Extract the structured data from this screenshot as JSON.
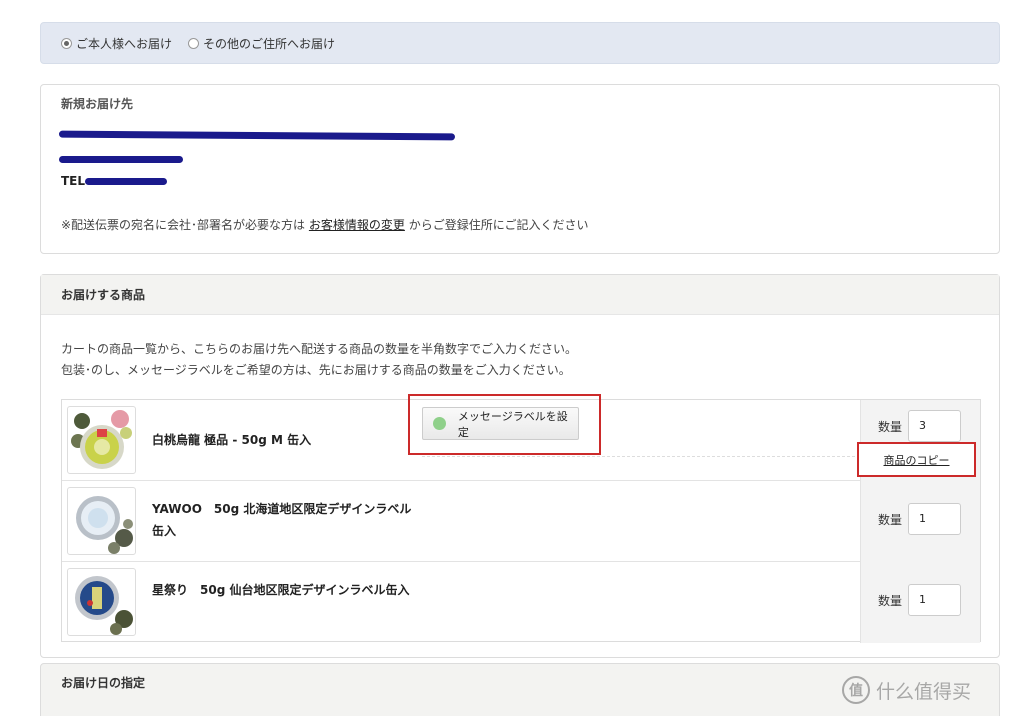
{
  "delivery_options": [
    {
      "label": "ご本人様へお届け",
      "selected": true
    },
    {
      "label": "その他のご住所へお届け",
      "selected": false
    }
  ],
  "address": {
    "title": "新規お届け先",
    "tel_prefix": "TEL",
    "note_prefix": "※配送伝票の宛名に会社･部署名が必要な方は",
    "note_link": "お客様情報の変更",
    "note_suffix": "からご登録住所にご記入ください"
  },
  "items_section": {
    "title": "お届けする商品",
    "instruction_1": "カートの商品一覧から、こちらのお届け先へ配送する商品の数量を半角数字でご入力ください。",
    "instruction_2": "包装･のし、メッセージラベルをご希望の方は、先にお届けする商品の数量をご入力ください。",
    "qty_label": "数量",
    "message_button": "メッセージラベルを設定",
    "copy_link": "商品のコピー",
    "products": [
      {
        "name": "白桃烏龍 極品 - 50g M 缶入",
        "qty": "3"
      },
      {
        "name": "YAWOO　50g 北海道地区限定デザインラベル缶入",
        "qty": "1"
      },
      {
        "name": "星祭り　50g 仙台地区限定デザインラベル缶入",
        "qty": "1"
      }
    ]
  },
  "date_section": {
    "title": "お届け日の指定"
  },
  "watermark": {
    "icon_text": "值",
    "text": "什么值得买"
  },
  "colors": {
    "highlight": "#cc2a2a",
    "redaction": "#1a1a8c"
  }
}
